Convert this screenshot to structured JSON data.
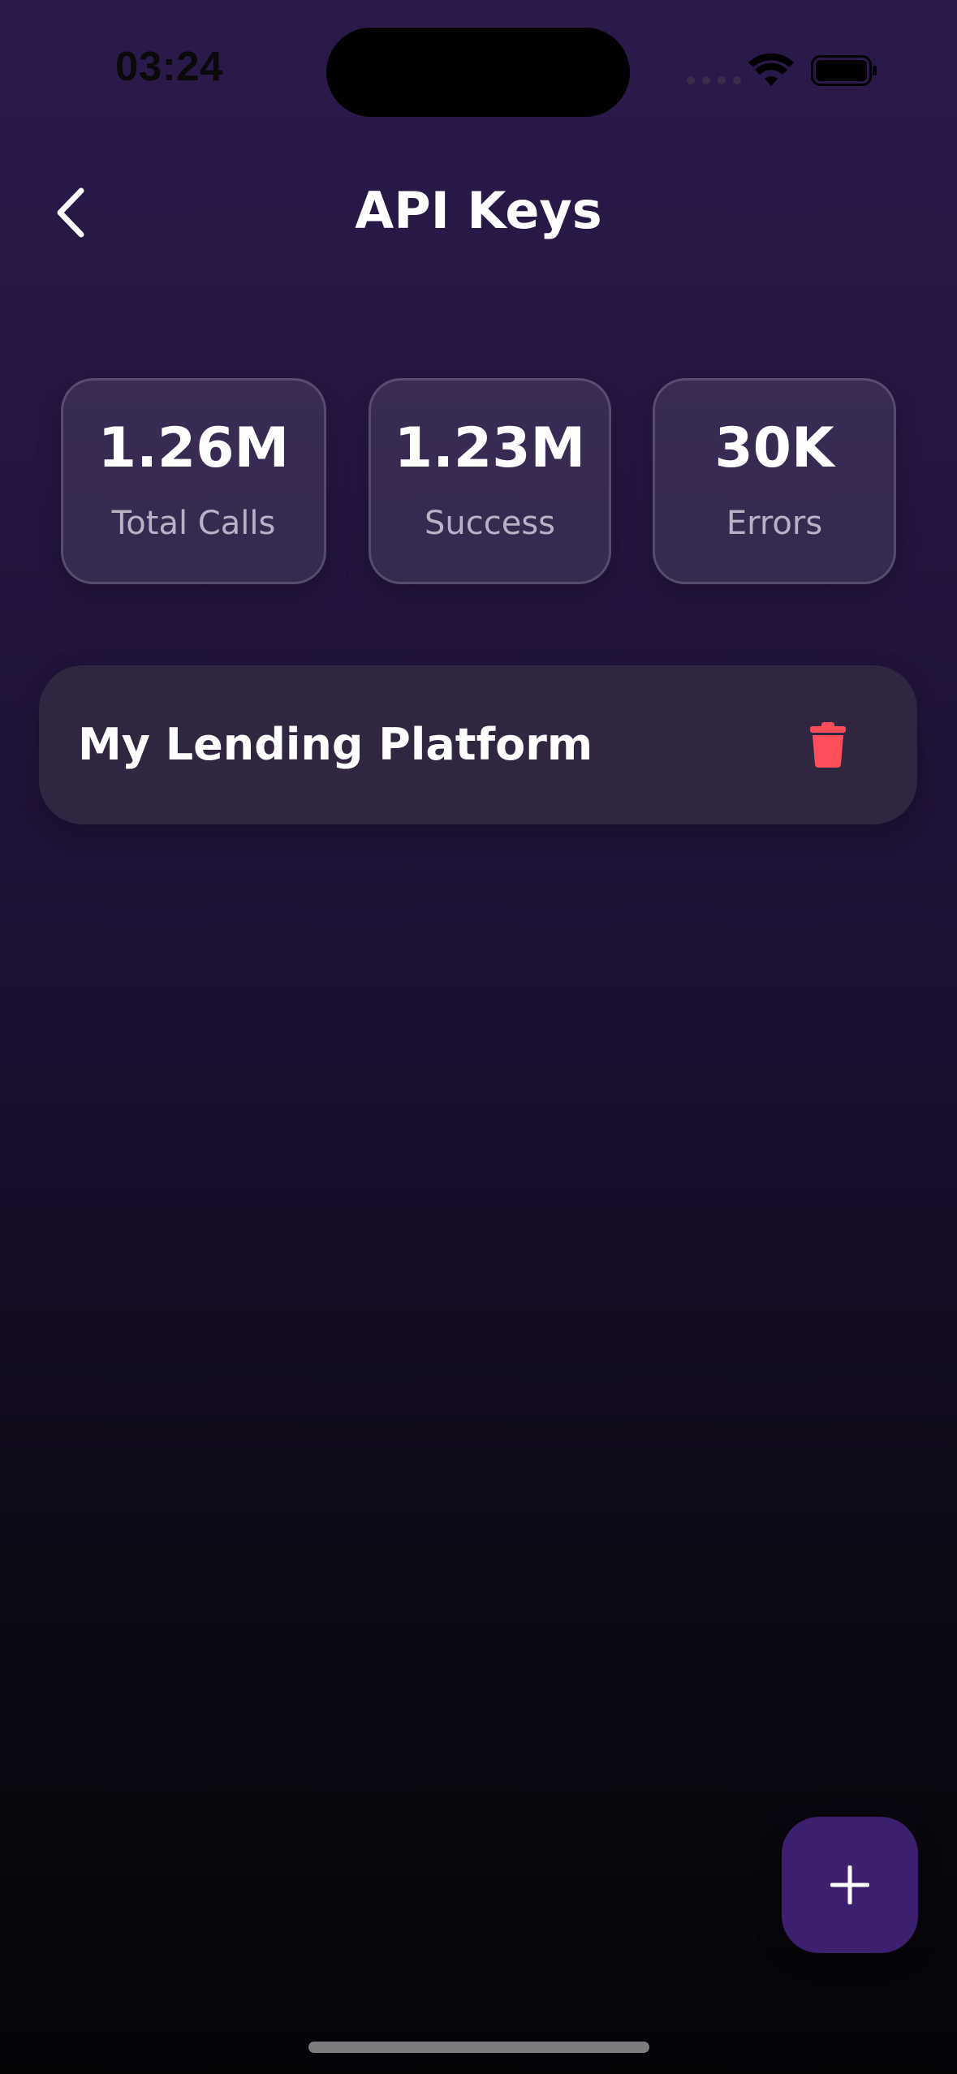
{
  "status_bar": {
    "time": "03:24",
    "icons": [
      "signal-dots-icon",
      "wifi-icon",
      "battery-icon"
    ]
  },
  "header": {
    "title": "API Keys",
    "back_icon": "chevron-left-icon"
  },
  "stats": [
    {
      "value": "1.26M",
      "label": "Total Calls"
    },
    {
      "value": "1.23M",
      "label": "Success"
    },
    {
      "value": "30K",
      "label": "Errors"
    }
  ],
  "api_keys": [
    {
      "name": "My Lending Platform",
      "action_icon": "trash-icon"
    }
  ],
  "fab": {
    "icon": "plus-icon"
  },
  "colors": {
    "background_top": "#2b1a4b",
    "background_bottom": "#050407",
    "card": "#302640",
    "danger": "#ff4d5a",
    "fab": "#3c1f6e",
    "label_text": "#b9b2c6"
  }
}
